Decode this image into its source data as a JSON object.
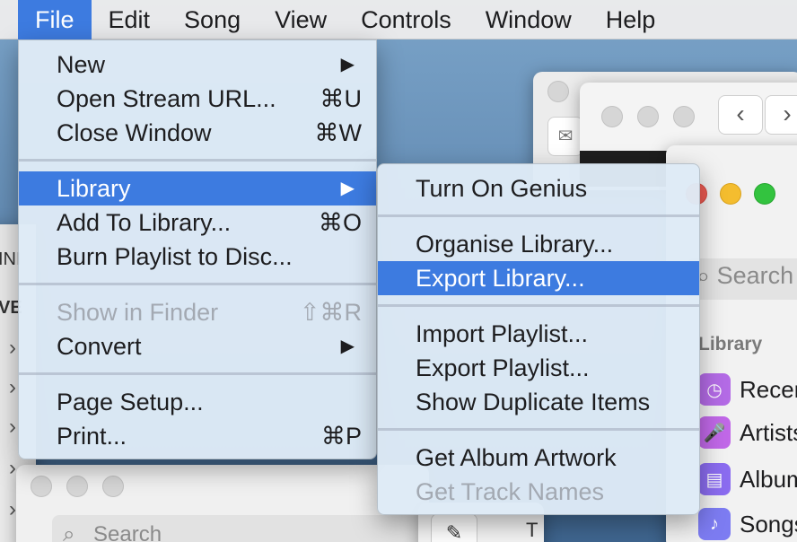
{
  "menubar": {
    "items": [
      "File",
      "Edit",
      "Song",
      "View",
      "Controls",
      "Window",
      "Help"
    ]
  },
  "file_menu": {
    "items": [
      {
        "label": "New",
        "shortcut": "",
        "submenu": true
      },
      {
        "label": "Open Stream URL...",
        "shortcut": "⌘U"
      },
      {
        "label": "Close Window",
        "shortcut": "⌘W"
      },
      {
        "label": "Library",
        "shortcut": "",
        "submenu": true
      },
      {
        "label": "Add To Library...",
        "shortcut": "⌘O"
      },
      {
        "label": "Burn Playlist to Disc...",
        "shortcut": ""
      },
      {
        "label": "Show in Finder",
        "shortcut": "⇧⌘R"
      },
      {
        "label": "Convert",
        "shortcut": "",
        "submenu": true
      },
      {
        "label": "Page Setup...",
        "shortcut": ""
      },
      {
        "label": "Print...",
        "shortcut": "⌘P"
      }
    ]
  },
  "library_submenu": {
    "items": [
      "Turn On Genius",
      "Organise Library...",
      "Export Library...",
      "Import Playlist...",
      "Export Playlist...",
      "Show Duplicate Items",
      "Get Album Artwork",
      "Get Track Names"
    ]
  },
  "music_window": {
    "search_placeholder": "Search",
    "section_label": "Library",
    "sidebar_items": [
      "Recently Added",
      "Artists",
      "Albums",
      "Songs"
    ]
  },
  "left_window": {
    "text_1": "INI",
    "text_2": "VE"
  },
  "bottom_window": {
    "search_placeholder": "Search",
    "partial_text": "T"
  },
  "glyphs": {
    "submenu_arrow": "▶",
    "nav_back": "‹",
    "nav_forward": "›",
    "chevron": "›"
  },
  "colors": {
    "highlight": "#3d7be0",
    "menu_bg": "#deeaf6",
    "disabled_text": "#a3a9b2"
  }
}
